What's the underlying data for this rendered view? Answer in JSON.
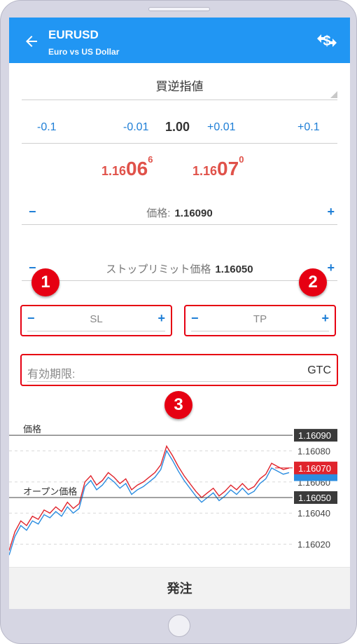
{
  "header": {
    "title": "EURUSD",
    "subtitle": "Euro vs US Dollar",
    "bg_color": "#2196f3",
    "back_icon": "arrow-left",
    "symbol_icon": "dollar-exchange"
  },
  "order_type": "買逆指値",
  "volume": {
    "minus_01": "-0.1",
    "minus_001": "-0.01",
    "value": "1.00",
    "plus_001": "+0.01",
    "plus_01": "+0.1"
  },
  "quotes": {
    "bid": {
      "prefix": "1.16",
      "big": "06",
      "sup": "6"
    },
    "ask": {
      "prefix": "1.16",
      "big": "07",
      "sup": "0"
    },
    "color": "#e0524a"
  },
  "price_field": {
    "minus": "−",
    "label": "価格:",
    "value": "1.16090",
    "plus": "+"
  },
  "stop_limit_field": {
    "minus": "−",
    "label": "ストップリミット価格",
    "value": "1.16050",
    "plus": "+"
  },
  "sl": {
    "minus": "−",
    "label": "SL",
    "plus": "+"
  },
  "tp": {
    "minus": "−",
    "label": "TP",
    "plus": "+"
  },
  "expiry": {
    "label": "有効期限:",
    "value": "GTC"
  },
  "badges": [
    "1",
    "2",
    "3"
  ],
  "highlight_color": "#e60012",
  "chart": {
    "price_label": "価格",
    "open_price_label": "オープン価格",
    "axis_ticks": [
      "1.16080",
      "1.16060",
      "1.16040",
      "1.16020"
    ],
    "tag_price": "1.16090",
    "tag_bid": "1.16070",
    "tag_open": "1.16050"
  },
  "chart_data": {
    "type": "line",
    "ylim": [
      1.16005,
      1.16095
    ],
    "price_level": 1.1609,
    "open_price_level": 1.1605,
    "series": [
      {
        "color": "#e0242c",
        "values": [
          1.16016,
          1.16028,
          1.16035,
          1.16032,
          1.16038,
          1.16036,
          1.16042,
          1.1604,
          1.16044,
          1.16041,
          1.16047,
          1.16043,
          1.16046,
          1.1606,
          1.16064,
          1.16058,
          1.16061,
          1.16066,
          1.16063,
          1.16059,
          1.16062,
          1.16055,
          1.16058,
          1.1606,
          1.16063,
          1.16066,
          1.16071,
          1.16083,
          1.16077,
          1.1607,
          1.16064,
          1.16059,
          1.16054,
          1.1605,
          1.16053,
          1.16056,
          1.16051,
          1.16054,
          1.16058,
          1.16055,
          1.16059,
          1.16055,
          1.16057,
          1.16062,
          1.16065,
          1.16072,
          1.1607,
          1.16068,
          1.16069
        ]
      },
      {
        "color": "#2b8de0",
        "values": [
          1.16013,
          1.16025,
          1.16032,
          1.16029,
          1.16035,
          1.16033,
          1.16039,
          1.16037,
          1.16041,
          1.16038,
          1.16044,
          1.1604,
          1.16043,
          1.16057,
          1.16061,
          1.16055,
          1.16058,
          1.16063,
          1.1606,
          1.16056,
          1.16059,
          1.16052,
          1.16055,
          1.16057,
          1.1606,
          1.16063,
          1.16068,
          1.1608,
          1.16074,
          1.16067,
          1.16061,
          1.16056,
          1.16051,
          1.16047,
          1.1605,
          1.16053,
          1.16048,
          1.16051,
          1.16055,
          1.16052,
          1.16056,
          1.16052,
          1.16054,
          1.16059,
          1.16062,
          1.16069,
          1.16067,
          1.16065,
          1.16066
        ]
      }
    ]
  },
  "submit_label": "発注"
}
